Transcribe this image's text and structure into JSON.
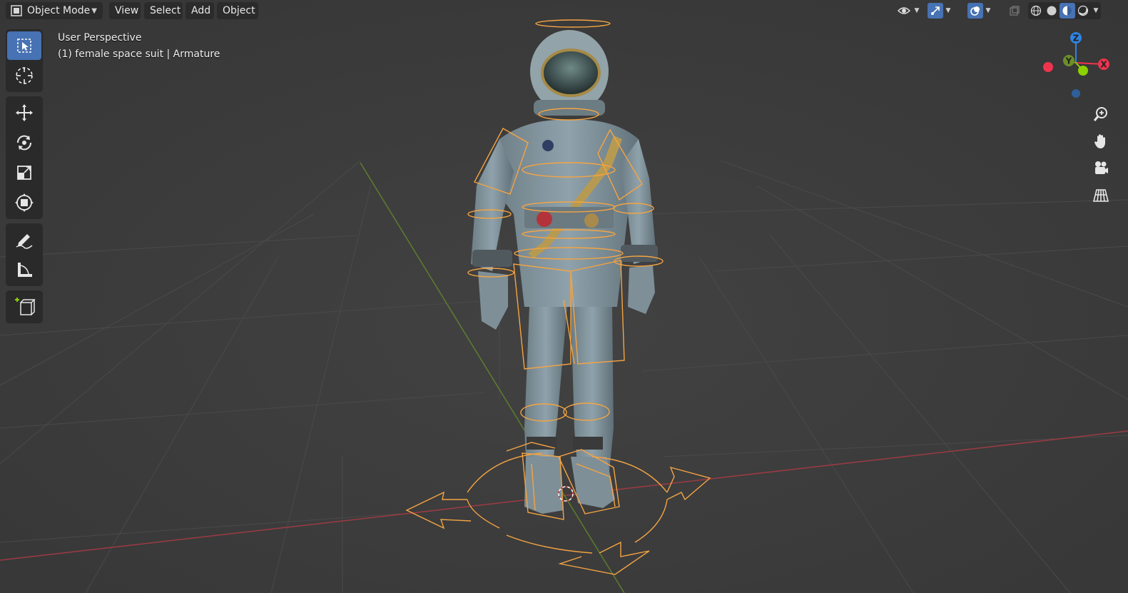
{
  "header": {
    "mode_label": "Object Mode",
    "menus": [
      "View",
      "Select",
      "Add",
      "Object"
    ]
  },
  "overlay": {
    "perspective": "User Perspective",
    "object_info": "(1) female space suit | Armature"
  },
  "toolbar": {
    "tools": [
      "select-box",
      "cursor",
      "move",
      "rotate",
      "scale",
      "transform",
      "annotate",
      "measure",
      "add-cube"
    ],
    "active_tool": "select-box"
  },
  "gizmo": {
    "x_label": "X",
    "y_label": "Y",
    "z_label": "Z"
  },
  "colors": {
    "x_axis": "#f0344e",
    "y_axis": "#8bd100",
    "z_axis": "#2f84e3",
    "selection_outline": "#f5a442",
    "active_tool": "#4772b3",
    "viewport_bg": "#3d3d3d"
  }
}
